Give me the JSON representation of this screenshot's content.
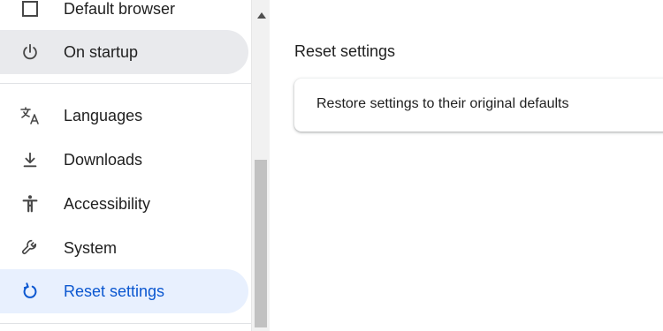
{
  "sidebar": {
    "items": [
      {
        "label": "Default browser",
        "icon": "browser-window-icon"
      },
      {
        "label": "On startup",
        "icon": "power-icon"
      },
      {
        "label": "Languages",
        "icon": "translate-icon"
      },
      {
        "label": "Downloads",
        "icon": "download-icon"
      },
      {
        "label": "Accessibility",
        "icon": "accessibility-icon"
      },
      {
        "label": "System",
        "icon": "wrench-icon"
      },
      {
        "label": "Reset settings",
        "icon": "reset-icon"
      }
    ]
  },
  "main": {
    "section_title": "Reset settings",
    "card": {
      "restore_label": "Restore settings to their original defaults"
    }
  },
  "colors": {
    "accent": "#0b57d0",
    "selected_bg": "#e8f0fe",
    "highlight_bg": "#e9eaed"
  }
}
